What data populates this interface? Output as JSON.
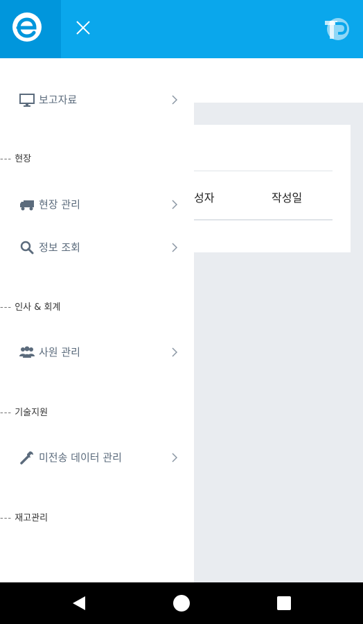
{
  "colors": {
    "topbar": "#0aa7ec",
    "logo_box": "#0096dc",
    "drawer_text": "#5b6b7c",
    "backdrop": "#e9ecf0"
  },
  "header": {
    "logo_icon": "e-logo-icon",
    "close_icon": "close-icon",
    "brand_icon": "tp-logo-icon"
  },
  "background_table": {
    "columns": [
      "성자",
      "작성일"
    ]
  },
  "drawer": {
    "items": [
      {
        "label": "보고자료",
        "icon": "monitor-icon"
      },
      {
        "label": "현장 관리",
        "icon": "truck-icon"
      },
      {
        "label": "정보 조회",
        "icon": "search-icon"
      },
      {
        "label": "사원 관리",
        "icon": "users-icon"
      },
      {
        "label": "미전송 데이터 관리",
        "icon": "wrench-icon"
      }
    ],
    "sections": [
      {
        "label": "현장"
      },
      {
        "label": "인사 & 회계"
      },
      {
        "label": "기술지원"
      },
      {
        "label": "재고관리"
      }
    ]
  },
  "navbar": {
    "back": "back-icon",
    "home": "home-icon",
    "recent": "recent-apps-icon"
  }
}
